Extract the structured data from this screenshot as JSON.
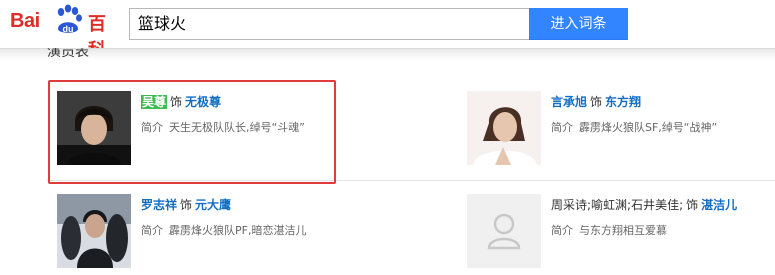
{
  "logo": {
    "bai": "Bai",
    "du": "du",
    "baike": "百科"
  },
  "search": {
    "query": "篮球火",
    "button_label": "进入词条"
  },
  "section": {
    "title": "演员表"
  },
  "colors": {
    "brand_red": "#de2c28",
    "search_blue": "#3385ff",
    "link_blue": "#136ec2",
    "highlight_green": "#3dbb51",
    "annotation_red": "#e23b3b"
  },
  "cast": [
    {
      "actor": "吴尊",
      "as": "饰",
      "roles": [
        "无极尊"
      ],
      "intro_label": "简介",
      "intro": "天生无极队队长,绰号“斗魂”",
      "highlighted": true
    },
    {
      "actor": "言承旭",
      "as": "饰",
      "roles": [
        "东方翔"
      ],
      "intro_label": "简介",
      "intro": "霹雳烽火狼队SF,绰号“战神”"
    },
    {
      "actor": "罗志祥",
      "as": "饰",
      "roles": [
        "元大鹰"
      ],
      "intro_label": "简介",
      "intro": "霹雳烽火狼队PF,暗恋湛洁儿"
    },
    {
      "actor": "周采诗;喻虹渊;石井美佳;",
      "as": "饰",
      "roles": [
        "湛洁儿"
      ],
      "intro_label": "简介",
      "intro": "与东方翔相互爱慕",
      "actor_parts": [
        "周采诗",
        "喻虹渊",
        "石井美佳"
      ]
    }
  ]
}
